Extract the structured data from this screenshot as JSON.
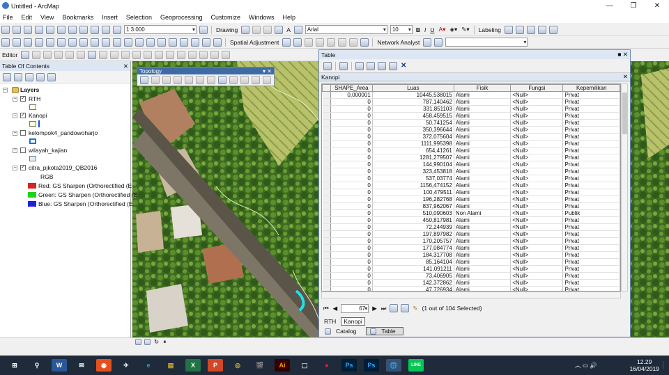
{
  "app": {
    "title": "Untitled - ArcMap"
  },
  "menu": [
    "File",
    "Edit",
    "View",
    "Bookmarks",
    "Insert",
    "Selection",
    "Geoprocessing",
    "Customize",
    "Windows",
    "Help"
  ],
  "toolbar": {
    "scale": "1:3.000",
    "drawing_label": "Drawing",
    "font_name": "Arial",
    "font_size": "10",
    "bold": "B",
    "italic": "I",
    "underline": "U",
    "labeling_label": "Labeling",
    "editor_label": "Editor",
    "spatial_adjustment_label": "Spatial Adjustment",
    "network_analyst_label": "Network Analyst"
  },
  "toc": {
    "title": "Table Of Contents",
    "root": "Layers",
    "layers": [
      {
        "name": "RTH",
        "checked": true
      },
      {
        "name": "Kanopi",
        "checked": true
      },
      {
        "name": "kelompok4_pandowoharjo",
        "checked": false
      },
      {
        "name": "wilayah_kajian",
        "checked": false
      },
      {
        "name": "citra_pjkota2019_QB2016",
        "checked": true
      }
    ],
    "rgb_label": "RGB",
    "bands": [
      {
        "label": "Red:",
        "value": "GS Sharpen (Orthorectified (E",
        "color": "#e02020"
      },
      {
        "label": "Green:",
        "value": "GS Sharpen (Orthorectified (E",
        "color": "#20d020"
      },
      {
        "label": "Blue:",
        "value": "GS Sharpen (Orthorectified (E",
        "color": "#2020e0"
      }
    ]
  },
  "topology": {
    "title": "Topology"
  },
  "table": {
    "window_title": "Table",
    "layer_name": "Kanopi",
    "columns": [
      "SHAPE_Area",
      "Luas",
      "Fisik",
      "Fungsi",
      "Kepemilikan"
    ],
    "rows": [
      [
        "0,000001",
        "10445,538015",
        "Alami",
        "<Null>",
        "Privat"
      ],
      [
        "0",
        "787,140462",
        "Alami",
        "<Null>",
        "Privat"
      ],
      [
        "0",
        "331,851103",
        "Alami",
        "<Null>",
        "Privat"
      ],
      [
        "0",
        "458,459515",
        "Alami",
        "<Null>",
        "Privat"
      ],
      [
        "0",
        "50,741254",
        "Alami",
        "<Null>",
        "Privat"
      ],
      [
        "0",
        "350,396644",
        "Alami",
        "<Null>",
        "Privat"
      ],
      [
        "0",
        "372,075604",
        "Alami",
        "<Null>",
        "Privat"
      ],
      [
        "0",
        "1111,995398",
        "Alami",
        "<Null>",
        "Privat"
      ],
      [
        "0",
        "654,41261",
        "Alami",
        "<Null>",
        "Privat"
      ],
      [
        "0",
        "1281,279507",
        "Alami",
        "<Null>",
        "Privat"
      ],
      [
        "0",
        "144,990104",
        "Alami",
        "<Null>",
        "Privat"
      ],
      [
        "0",
        "323,453818",
        "Alami",
        "<Null>",
        "Privat"
      ],
      [
        "0",
        "537,03774",
        "Alami",
        "<Null>",
        "Privat"
      ],
      [
        "0",
        "1156,474152",
        "Alami",
        "<Null>",
        "Privat"
      ],
      [
        "0",
        "100,479511",
        "Alami",
        "<Null>",
        "Privat"
      ],
      [
        "0",
        "196,282768",
        "Alami",
        "<Null>",
        "Privat"
      ],
      [
        "0",
        "837,962067",
        "Alami",
        "<Null>",
        "Privat"
      ],
      [
        "0",
        "510,090603",
        "Non Alami",
        "<Null>",
        "Publik"
      ],
      [
        "0",
        "450,817981",
        "Alami",
        "<Null>",
        "Privat"
      ],
      [
        "0",
        "72,244939",
        "Alami",
        "<Null>",
        "Privat"
      ],
      [
        "0",
        "197,897982",
        "Alami",
        "<Null>",
        "Privat"
      ],
      [
        "0",
        "170,205757",
        "Alami",
        "<Null>",
        "Privat"
      ],
      [
        "0",
        "177,084774",
        "Alami",
        "<Null>",
        "Privat"
      ],
      [
        "0",
        "184,317708",
        "Alami",
        "<Null>",
        "Privat"
      ],
      [
        "0",
        "85,164104",
        "Alami",
        "<Null>",
        "Privat"
      ],
      [
        "0",
        "141,091211",
        "Alami",
        "<Null>",
        "Privat"
      ],
      [
        "0",
        "73,406905",
        "Alami",
        "<Null>",
        "Privat"
      ],
      [
        "0",
        "142,372862",
        "Alami",
        "<Null>",
        "Privat"
      ],
      [
        "0",
        "47,726934",
        "Alami",
        "<Null>",
        "Privat"
      ],
      [
        "0",
        "128,709050",
        "Alami",
        "<Null>",
        "Privat"
      ]
    ],
    "record_number": "67",
    "selection_status": "(1 out of 104 Selected)",
    "bottom_tabs": [
      "RTH",
      "Kanopi"
    ],
    "dock_tabs": [
      "Catalog",
      "Table"
    ]
  },
  "clock": {
    "time": "12.29",
    "date": "16/04/2019"
  },
  "taskbar": [
    "W",
    "✉",
    "◉",
    "✈",
    "e",
    "▤",
    "X",
    "P",
    "◎",
    "🎬",
    "Ai",
    "⬚",
    "●",
    "Ps",
    "Ps",
    "🌐",
    "LINE"
  ]
}
